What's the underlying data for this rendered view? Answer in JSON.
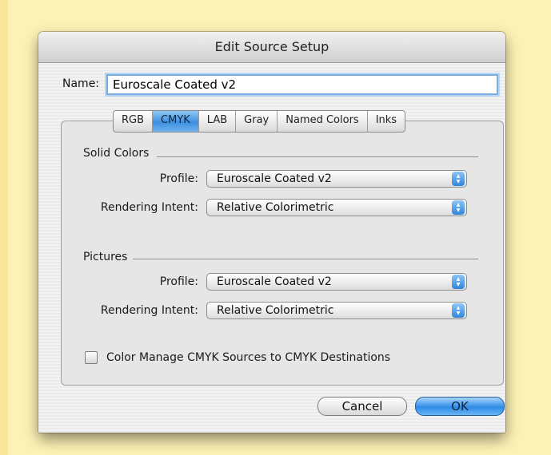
{
  "dialog": {
    "title": "Edit Source Setup"
  },
  "name_field": {
    "label": "Name:",
    "value": "Euroscale Coated v2"
  },
  "tabs": [
    {
      "label": "RGB",
      "active": false
    },
    {
      "label": "CMYK",
      "active": true
    },
    {
      "label": "LAB",
      "active": false
    },
    {
      "label": "Gray",
      "active": false
    },
    {
      "label": "Named Colors",
      "active": false
    },
    {
      "label": "Inks",
      "active": false
    }
  ],
  "solid_colors": {
    "title": "Solid Colors",
    "profile_label": "Profile:",
    "profile_value": "Euroscale Coated v2",
    "intent_label": "Rendering Intent:",
    "intent_value": "Relative Colorimetric"
  },
  "pictures": {
    "title": "Pictures",
    "profile_label": "Profile:",
    "profile_value": "Euroscale Coated v2",
    "intent_label": "Rendering Intent:",
    "intent_value": "Relative Colorimetric"
  },
  "option": {
    "label": "Color Manage CMYK Sources to CMYK Destinations",
    "checked": false
  },
  "buttons": {
    "cancel": "Cancel",
    "ok": "OK"
  },
  "colors": {
    "page_background": "#fdf2b6",
    "accent_blue": "#3d8fdf"
  }
}
